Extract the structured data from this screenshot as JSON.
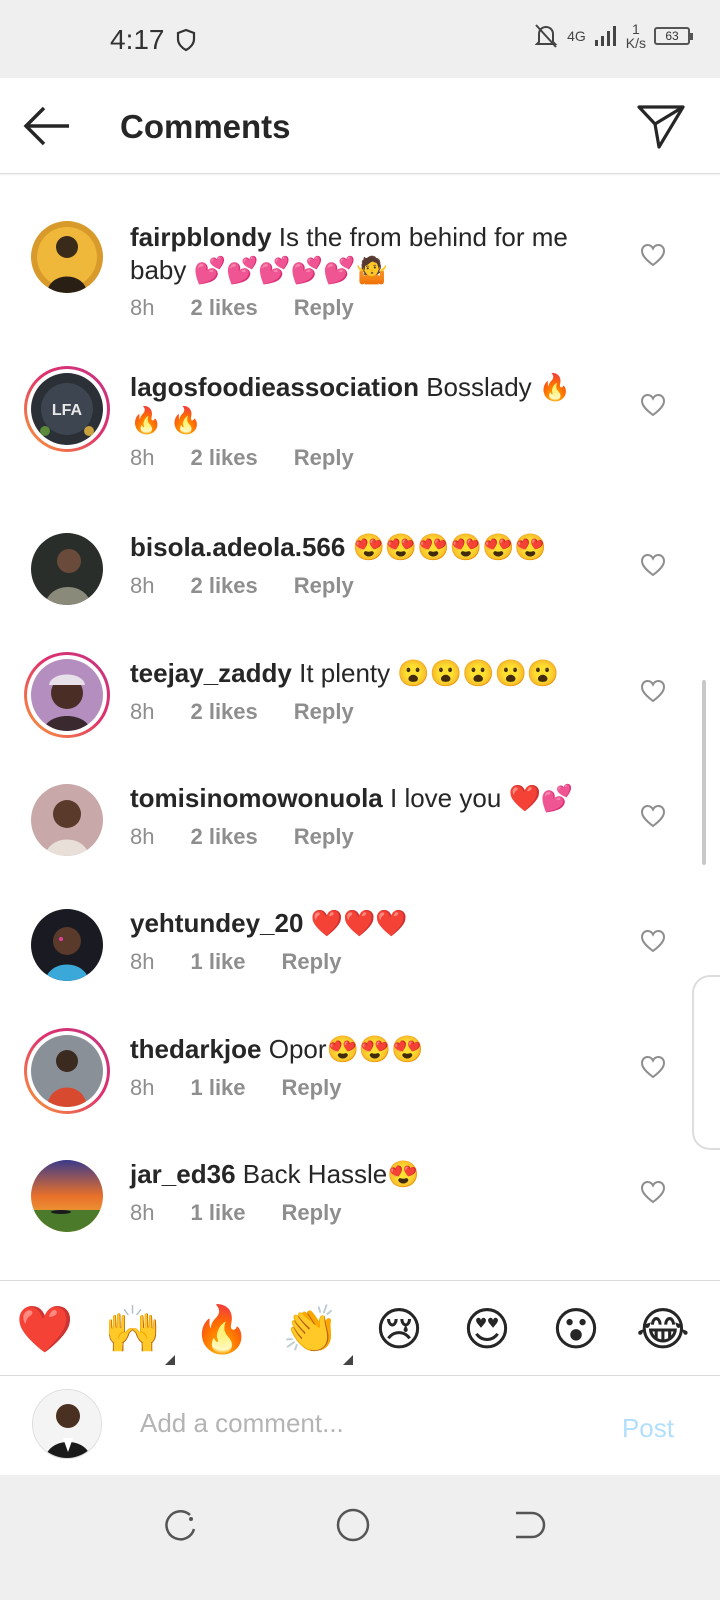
{
  "status_bar": {
    "time": "4:17",
    "network": "4G",
    "speed_value": "1",
    "speed_unit": "K/s",
    "battery": "63"
  },
  "header": {
    "title": "Comments"
  },
  "comments": [
    {
      "username": "fairpblondy",
      "text": "Is the from behind for me baby 💕💕💕💕💕🤷",
      "time": "8h",
      "likes": "2 likes",
      "reply": "Reply"
    },
    {
      "username": "lagosfoodieassociation",
      "text": "Bosslady 🔥 🔥 🔥",
      "time": "8h",
      "likes": "2 likes",
      "reply": "Reply",
      "avatar_text": "LFA"
    },
    {
      "username": "bisola.adeola.566",
      "text": "😍😍😍😍😍😍",
      "time": "8h",
      "likes": "2 likes",
      "reply": "Reply"
    },
    {
      "username": "teejay_zaddy",
      "text": "It plenty 😮😮😮😮😮",
      "time": "8h",
      "likes": "2 likes",
      "reply": "Reply"
    },
    {
      "username": "tomisinomowonuola",
      "text": "I love you ❤️💕",
      "time": "8h",
      "likes": "2 likes",
      "reply": "Reply"
    },
    {
      "username": "yehtundey_20",
      "text": "❤️❤️❤️",
      "time": "8h",
      "likes": "1 like",
      "reply": "Reply"
    },
    {
      "username": "thedarkjoe",
      "text": "Opor😍😍😍",
      "time": "8h",
      "likes": "1 like",
      "reply": "Reply"
    },
    {
      "username": "jar_ed36",
      "text": "Back Hassle😍",
      "time": "8h",
      "likes": "1 like",
      "reply": "Reply"
    }
  ],
  "reactions": [
    "❤️",
    "🙌",
    "🔥",
    "👏",
    "😢",
    "😍",
    "😮",
    "😂"
  ],
  "composer": {
    "placeholder": "Add a comment...",
    "post_label": "Post"
  },
  "colors": {
    "text": "#262626",
    "secondary": "#8e8e8e",
    "post_disabled": "#b2dffc",
    "story_ring_start": "#f9a037",
    "story_ring_end": "#c13584"
  }
}
